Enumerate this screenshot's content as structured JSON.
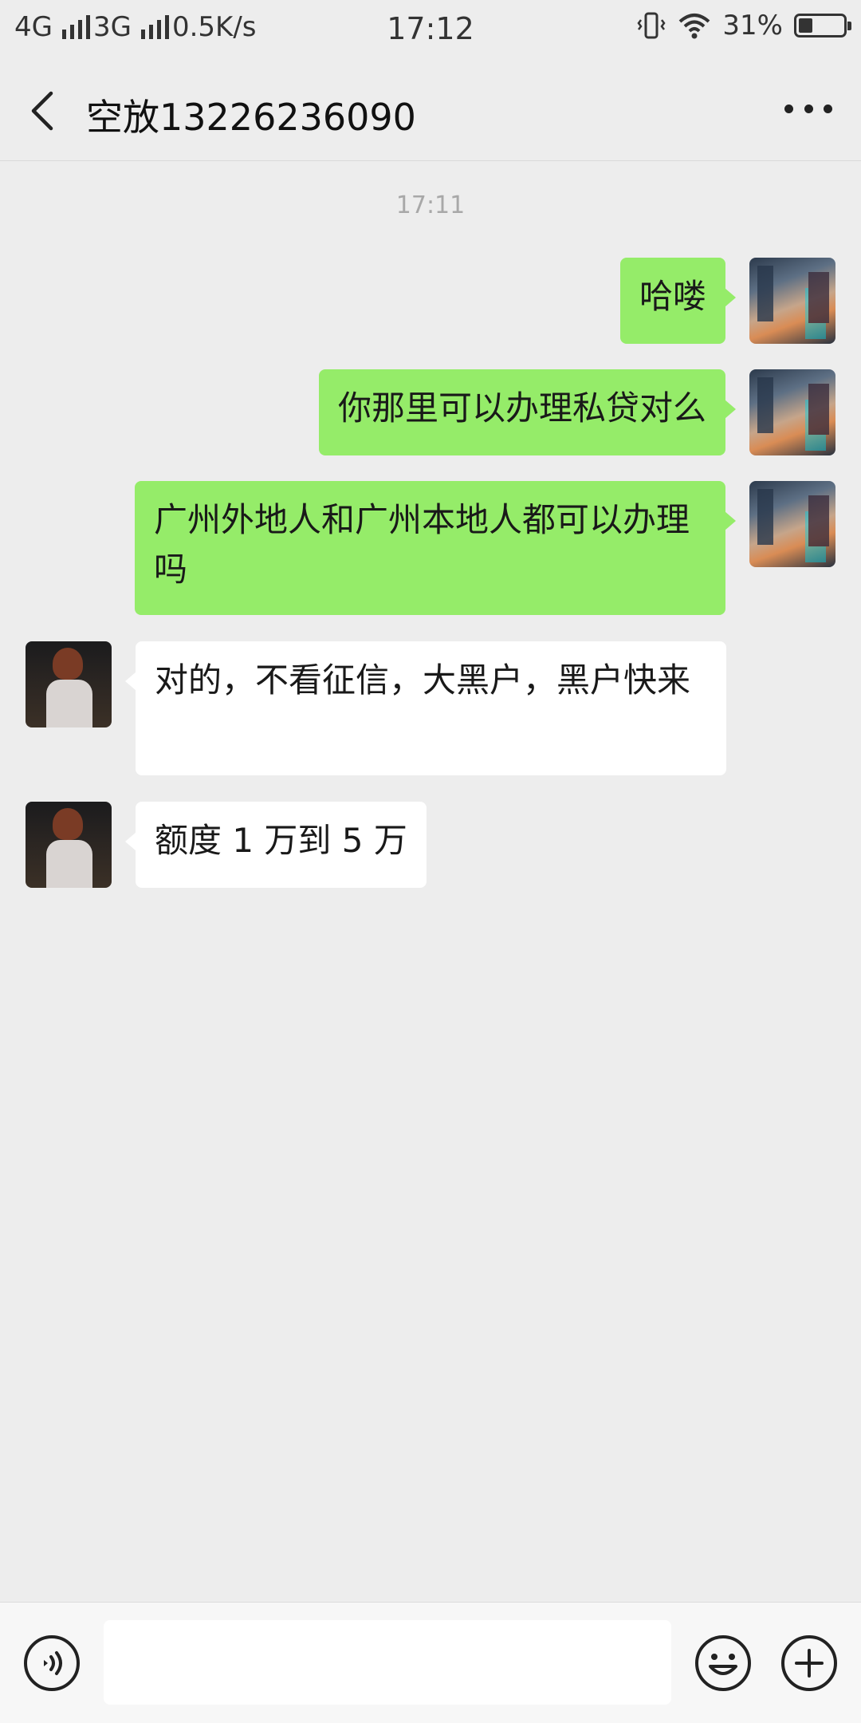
{
  "status_bar": {
    "net1": "4G",
    "net2": "3G",
    "speed": "0.5K/s",
    "time": "17:12",
    "battery_text": "31%",
    "battery_level": 0.31
  },
  "nav": {
    "title": "空放13226236090"
  },
  "chat": {
    "timestamp": "17:11",
    "messages": [
      {
        "side": "sent",
        "text": "哈喽"
      },
      {
        "side": "sent",
        "text": "你那里可以办理私贷对么"
      },
      {
        "side": "sent",
        "text": "广州外地人和广州本地人都可以办理吗"
      },
      {
        "side": "recv",
        "text": "对的，不看征信，大黑户，黑户快来"
      },
      {
        "side": "recv",
        "text": "额度 1 万到 5 万"
      }
    ]
  },
  "input": {
    "value": ""
  },
  "colors": {
    "sent_bubble": "#95ec69",
    "recv_bubble": "#ffffff",
    "background": "#ededed"
  }
}
